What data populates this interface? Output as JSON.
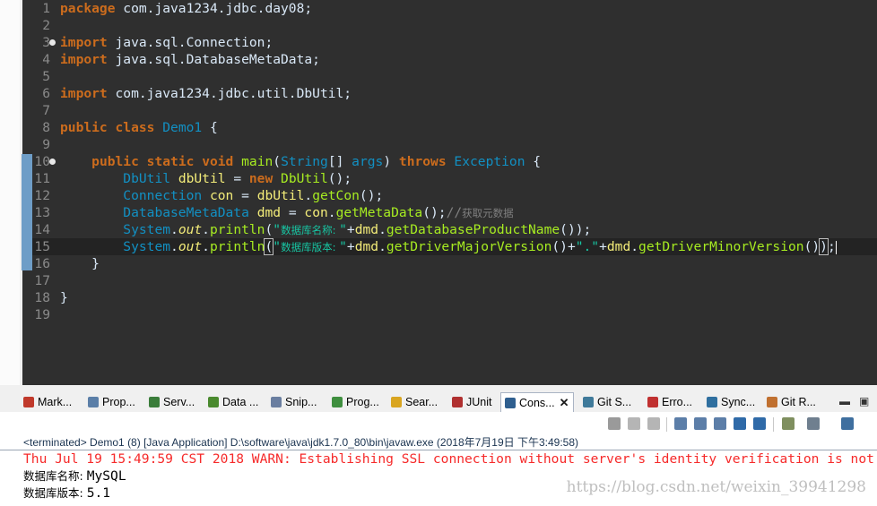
{
  "editor": {
    "lines": [
      {
        "num": "1",
        "tokens": [
          {
            "t": "package",
            "c": "kw"
          },
          {
            "t": " com.java1234.jdbc.day08;",
            "c": ""
          }
        ]
      },
      {
        "num": "2",
        "tokens": []
      },
      {
        "num": "3",
        "fold": true,
        "tokens": [
          {
            "t": "import",
            "c": "kw"
          },
          {
            "t": " java.sql.Connection;",
            "c": ""
          }
        ]
      },
      {
        "num": "4",
        "tokens": [
          {
            "t": "import",
            "c": "kw"
          },
          {
            "t": " java.sql.DatabaseMetaData;",
            "c": ""
          }
        ]
      },
      {
        "num": "5",
        "tokens": []
      },
      {
        "num": "6",
        "tokens": [
          {
            "t": "import",
            "c": "kw"
          },
          {
            "t": " com.java1234.jdbc.util.DbUtil;",
            "c": ""
          }
        ]
      },
      {
        "num": "7",
        "tokens": []
      },
      {
        "num": "8",
        "tokens": [
          {
            "t": "public",
            "c": "kw"
          },
          {
            "t": " ",
            "c": ""
          },
          {
            "t": "class",
            "c": "kw"
          },
          {
            "t": " ",
            "c": ""
          },
          {
            "t": "Demo1",
            "c": "ty"
          },
          {
            "t": " {",
            "c": ""
          }
        ]
      },
      {
        "num": "9",
        "tokens": []
      },
      {
        "num": "10",
        "fold": true,
        "tokens": [
          {
            "t": "    ",
            "c": ""
          },
          {
            "t": "public",
            "c": "kw"
          },
          {
            "t": " ",
            "c": ""
          },
          {
            "t": "static",
            "c": "kw"
          },
          {
            "t": " ",
            "c": ""
          },
          {
            "t": "void",
            "c": "kw"
          },
          {
            "t": " ",
            "c": ""
          },
          {
            "t": "main",
            "c": "fn"
          },
          {
            "t": "(",
            "c": ""
          },
          {
            "t": "String",
            "c": "ty"
          },
          {
            "t": "[] ",
            "c": ""
          },
          {
            "t": "args",
            "c": "ty"
          },
          {
            "t": ") ",
            "c": ""
          },
          {
            "t": "throws",
            "c": "kw"
          },
          {
            "t": " ",
            "c": ""
          },
          {
            "t": "Exception",
            "c": "ty"
          },
          {
            "t": " {",
            "c": ""
          }
        ]
      },
      {
        "num": "11",
        "tokens": [
          {
            "t": "        ",
            "c": ""
          },
          {
            "t": "DbUtil",
            "c": "ty"
          },
          {
            "t": " ",
            "c": ""
          },
          {
            "t": "dbUtil",
            "c": "lv"
          },
          {
            "t": " = ",
            "c": ""
          },
          {
            "t": "new",
            "c": "kw"
          },
          {
            "t": " ",
            "c": ""
          },
          {
            "t": "DbUtil",
            "c": "fn"
          },
          {
            "t": "();",
            "c": ""
          }
        ]
      },
      {
        "num": "12",
        "tokens": [
          {
            "t": "        ",
            "c": ""
          },
          {
            "t": "Connection",
            "c": "ty"
          },
          {
            "t": " ",
            "c": ""
          },
          {
            "t": "con",
            "c": "lv"
          },
          {
            "t": " = ",
            "c": ""
          },
          {
            "t": "dbUtil",
            "c": "lv"
          },
          {
            "t": ".",
            "c": ""
          },
          {
            "t": "getCon",
            "c": "fn"
          },
          {
            "t": "();",
            "c": ""
          }
        ]
      },
      {
        "num": "13",
        "tokens": [
          {
            "t": "        ",
            "c": ""
          },
          {
            "t": "DatabaseMetaData",
            "c": "ty"
          },
          {
            "t": " ",
            "c": ""
          },
          {
            "t": "dmd",
            "c": "lv"
          },
          {
            "t": " = ",
            "c": ""
          },
          {
            "t": "con",
            "c": "lv"
          },
          {
            "t": ".",
            "c": ""
          },
          {
            "t": "getMetaData",
            "c": "fn"
          },
          {
            "t": "();",
            "c": ""
          },
          {
            "t": "//",
            "c": "cm"
          },
          {
            "t": "获取元数据",
            "c": "cm cmcj"
          }
        ]
      },
      {
        "num": "14",
        "tokens": [
          {
            "t": "        ",
            "c": ""
          },
          {
            "t": "System",
            "c": "ty"
          },
          {
            "t": ".",
            "c": ""
          },
          {
            "t": "out",
            "c": "lv it"
          },
          {
            "t": ".",
            "c": ""
          },
          {
            "t": "println",
            "c": "fn"
          },
          {
            "t": "(",
            "c": ""
          },
          {
            "t": "\"",
            "c": "st"
          },
          {
            "t": "数据库名称: ",
            "c": "st stcj"
          },
          {
            "t": "\"",
            "c": "st"
          },
          {
            "t": "+",
            "c": ""
          },
          {
            "t": "dmd",
            "c": "lv"
          },
          {
            "t": ".",
            "c": ""
          },
          {
            "t": "getDatabaseProductName",
            "c": "fn"
          },
          {
            "t": "());",
            "c": ""
          }
        ]
      },
      {
        "num": "15",
        "cur": true,
        "tokens": [
          {
            "t": "        ",
            "c": ""
          },
          {
            "t": "System",
            "c": "ty"
          },
          {
            "t": ".",
            "c": ""
          },
          {
            "t": "out",
            "c": "lv it"
          },
          {
            "t": ".",
            "c": ""
          },
          {
            "t": "println",
            "c": "fn"
          },
          {
            "t": "(",
            "c": "brk"
          },
          {
            "t": "\"",
            "c": "st"
          },
          {
            "t": "数据库版本: ",
            "c": "st stcj"
          },
          {
            "t": "\"",
            "c": "st"
          },
          {
            "t": "+",
            "c": ""
          },
          {
            "t": "dmd",
            "c": "lv"
          },
          {
            "t": ".",
            "c": ""
          },
          {
            "t": "getDriverMajorVersion",
            "c": "fn"
          },
          {
            "t": "()+",
            "c": ""
          },
          {
            "t": "\".\"",
            "c": "st"
          },
          {
            "t": "+",
            "c": ""
          },
          {
            "t": "dmd",
            "c": "lv"
          },
          {
            "t": ".",
            "c": ""
          },
          {
            "t": "getDriverMinorVersion",
            "c": "fn"
          },
          {
            "t": "()",
            "c": ""
          },
          {
            "t": ")",
            "c": "brk"
          },
          {
            "t": ";",
            "c": ""
          }
        ]
      },
      {
        "num": "16",
        "tokens": [
          {
            "t": "    }",
            "c": ""
          }
        ]
      },
      {
        "num": "17",
        "tokens": []
      },
      {
        "num": "18",
        "tokens": [
          {
            "t": "}",
            "c": ""
          }
        ]
      },
      {
        "num": "19",
        "tokens": []
      }
    ]
  },
  "views": {
    "tabs": [
      {
        "label": "Mark...",
        "icon": "markers-icon",
        "color": "#c0392b"
      },
      {
        "label": "Prop...",
        "icon": "properties-icon",
        "color": "#5b7fa8"
      },
      {
        "label": "Serv...",
        "icon": "servers-icon",
        "color": "#3a7d3a"
      },
      {
        "label": "Data ...",
        "icon": "data-source-icon",
        "color": "#4a8a2e"
      },
      {
        "label": "Snip...",
        "icon": "snippets-icon",
        "color": "#6a7ea0"
      },
      {
        "label": "Prog...",
        "icon": "progress-icon",
        "color": "#3f8f3f"
      },
      {
        "label": "Sear...",
        "icon": "search-icon",
        "color": "#d9a520"
      },
      {
        "label": "JUnit",
        "icon": "junit-icon",
        "color": "#b03030"
      },
      {
        "label": "Cons...",
        "icon": "console-icon",
        "color": "#2f5f8f"
      },
      {
        "label": "Git S...",
        "icon": "git-staging-icon",
        "color": "#3f7a9a"
      },
      {
        "label": "Erro...",
        "icon": "error-log-icon",
        "color": "#c03030"
      },
      {
        "label": "Sync...",
        "icon": "synchronize-icon",
        "color": "#2f6f9f"
      },
      {
        "label": "Git R...",
        "icon": "git-repositories-icon",
        "color": "#c07030"
      }
    ],
    "active_tab": "Cons...",
    "close_glyph": "✕",
    "minimize_glyph": "▬",
    "maximize_glyph": "▣"
  },
  "console": {
    "status": "<terminated> Demo1 (8) [Java Application] D:\\software\\java\\jdk1.7.0_80\\bin\\javaw.exe (2018年7月19日 下午3:49:58)",
    "lines": [
      {
        "text": "Thu Jul 19 15:49:59 CST 2018 WARN: Establishing SSL connection without server's identity verification is not",
        "err": true
      },
      {
        "label": "数据库名称: ",
        "value": "MySQL"
      },
      {
        "label": "数据库版本: ",
        "value": "5.1"
      }
    ],
    "watermark": "https://blog.csdn.net/weixin_39941298"
  }
}
